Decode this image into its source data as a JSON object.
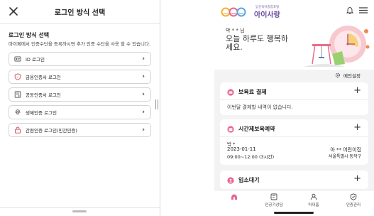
{
  "left_screen": {
    "title": "로그인 방식 선택",
    "section_title": "로그인 방식 선택",
    "description": "마이페에서 인증수단을 등록하시면 추가 인증 수단을 사용 할 수 있습니다.",
    "options": [
      {
        "label": "ID 로그인",
        "icon": "id-card-icon"
      },
      {
        "label": "금융인증서 로그인",
        "icon": "financial-cert-icon"
      },
      {
        "label": "공동인증서 로그인",
        "icon": "joint-cert-icon"
      },
      {
        "label": "생체인증 로그인",
        "icon": "fingerprint-icon"
      },
      {
        "label": "간편인증 로그인(민간인증)",
        "icon": "simple-auth-icon"
      }
    ],
    "chevron": "›",
    "close_icon": "close-icon"
  },
  "right_screen": {
    "brand_sub": "임신육아종합포털",
    "brand": "아이사랑",
    "user_name": "박 * * 님",
    "greeting": "오늘 하루도 행복하세요.",
    "settings_label": "메인설정",
    "cards": {
      "childcare_payment": {
        "title": "보육료 결제",
        "message": "이번달 결제할 내역이 없습니다."
      },
      "timed_care": {
        "title": "시간제보육예약",
        "child": "박 *",
        "date": "2023-01-11",
        "time": "09:00~12:00 (3시간)",
        "center": "아 ** 어린이집",
        "region": "서울특별시 동작구"
      },
      "waitlist": {
        "title": "입소대기"
      }
    },
    "tabs": [
      {
        "label": "",
        "icon": "home-icon"
      },
      {
        "label": "인공기상담",
        "icon": "consult-icon"
      },
      {
        "label": "마이홈",
        "icon": "person-icon"
      },
      {
        "label": "인증관리",
        "icon": "shield-icon"
      }
    ],
    "colors": {
      "accent_pink": "#e8678d",
      "brand_purple": "#6b4aa0"
    }
  }
}
